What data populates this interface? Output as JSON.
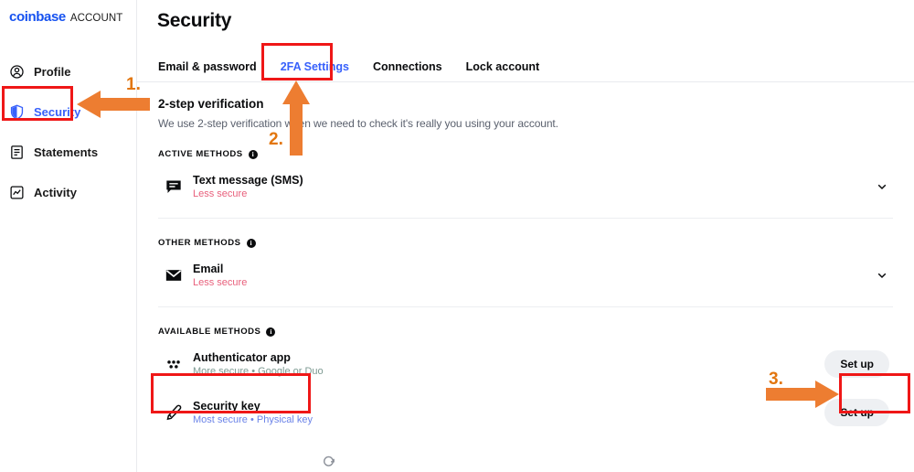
{
  "brand": {
    "name": "coinbase",
    "suffix": "ACCOUNT"
  },
  "sidebar": {
    "items": [
      {
        "label": "Profile",
        "icon": "user-circle-icon",
        "active": false
      },
      {
        "label": "Security",
        "icon": "shield-icon",
        "active": true
      },
      {
        "label": "Statements",
        "icon": "document-icon",
        "active": false
      },
      {
        "label": "Activity",
        "icon": "activity-chart-icon",
        "active": false
      }
    ]
  },
  "header": {
    "title": "Security"
  },
  "tabs": [
    {
      "label": "Email & password",
      "active": false
    },
    {
      "label": "2FA Settings",
      "active": true
    },
    {
      "label": "Connections",
      "active": false
    },
    {
      "label": "Lock account",
      "active": false
    }
  ],
  "section": {
    "title": "2-step verification",
    "description": "We use 2-step verification when we need to check it's really you using your account."
  },
  "groups": [
    {
      "label": "ACTIVE METHODS",
      "info_icon": "info-icon",
      "methods": [
        {
          "name": "Text message (SMS)",
          "sub": "Less secure",
          "sub_style": "less",
          "icon": "message-bubble-icon",
          "action": "chevron-down-icon"
        }
      ]
    },
    {
      "label": "OTHER METHODS",
      "info_icon": "info-icon",
      "methods": [
        {
          "name": "Email",
          "sub": "Less secure",
          "sub_style": "less",
          "icon": "envelope-icon",
          "action": "chevron-down-icon"
        }
      ]
    },
    {
      "label": "AVAILABLE METHODS",
      "info_icon": "info-icon",
      "methods": [
        {
          "name": "Authenticator app",
          "sub": "More secure • Google or Duo",
          "sub_style": "more",
          "icon": "dots-grid-icon",
          "action": "Set up"
        },
        {
          "name": "Security key",
          "sub": "Most secure • Physical key",
          "sub_style": "most",
          "icon": "key-icon",
          "action": "Set up"
        }
      ]
    }
  ],
  "annotations": {
    "steps": [
      {
        "number": "1.",
        "target": "sidebar-item-security"
      },
      {
        "number": "2.",
        "target": "tab-2fa-settings"
      },
      {
        "number": "3.",
        "target": "authenticator-setup-button"
      }
    ],
    "arrow_color": "#ED7D31",
    "highlight_color": "#EF1717"
  },
  "colors": {
    "brand_blue": "#1652f0",
    "link_blue": "#3861fb",
    "less_secure": "#e8607c",
    "more_secure": "#7d9a92",
    "most_secure": "#6b83e8",
    "button_bg": "#eef0f3"
  },
  "cursor": {
    "icon": "reload-cursor-icon"
  }
}
